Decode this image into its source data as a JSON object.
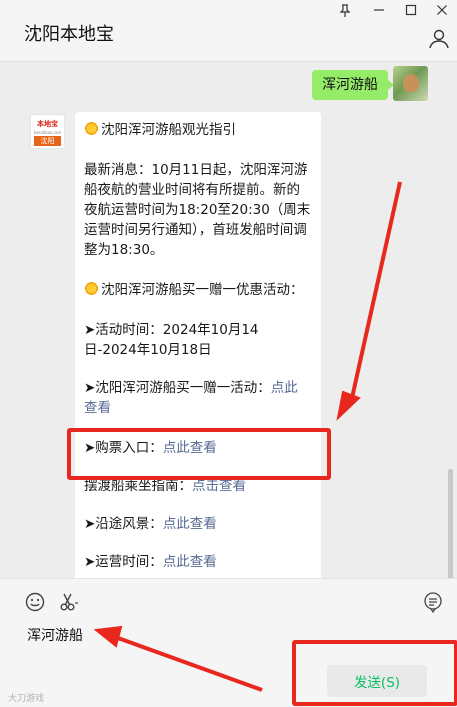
{
  "window": {
    "title": "沈阳本地宝",
    "pin_icon": "pin-icon",
    "minimize_icon": "minimize-icon",
    "maximize_icon": "maximize-icon",
    "close_icon": "close-icon",
    "user_icon": "user-icon"
  },
  "chat": {
    "sent_message": "浑河游船",
    "sender_avatar": {
      "brand_top": "本地宝",
      "brand_url": "bendibao.com",
      "brand_city": "沈阳"
    },
    "card": {
      "heading": "沈阳浑河游船观光指引",
      "news": "最新消息：10月11日起，沈阳浑河游船夜航的营业时间将有所提前。新的夜航运营时间为18:20至20:30（周末运营时间另行通知），首班发船时间调整为18:30。",
      "promo_heading": "沈阳浑河游船买一赠一优惠活动：",
      "activity_time": "➤活动时间：2024年10月14日-2024年10月18日",
      "promo_label": "➤沈阳浑河游船买一赠一活动：",
      "promo_link": "点此查看",
      "ticket_label": "➤购票入口：",
      "ticket_link": "点此查看",
      "ferry_label": "摆渡船乘坐指南：",
      "ferry_link": "点击查看",
      "scenery_label": "➤沿途风景：",
      "scenery_link": "点此查看",
      "hours_label": "➤运营时间：",
      "hours_link": "点此查看"
    }
  },
  "composer": {
    "emoji_icon": "emoji-icon",
    "scissors_icon": "scissors-icon",
    "chat_history_icon": "chat-history-icon",
    "input_value": "浑河游船",
    "send_label": "发送(S)",
    "watermark": "大刀游戏"
  },
  "colors": {
    "bubble_green": "#95ec69",
    "link_blue": "#576b95",
    "send_green": "#07c160",
    "highlight_red": "#e8281e"
  }
}
